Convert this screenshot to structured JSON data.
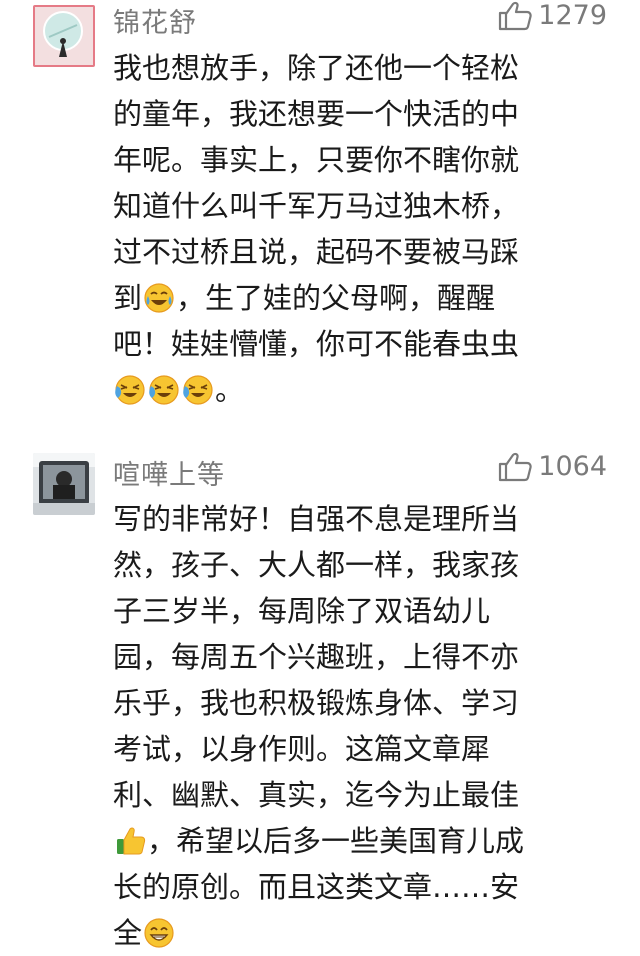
{
  "comments": [
    {
      "username": "锦花舒",
      "likes": "1279",
      "lines": [
        [
          "我也想放手，除了还他一个轻松"
        ],
        [
          "的童年，我还想要一个快活的中"
        ],
        [
          "年呢。事实上，只要你不瞎你就"
        ],
        [
          "知道什么叫千军万马过独木桥，"
        ],
        [
          "过不过桥且说，起码不要被马踩"
        ],
        [
          "到",
          "，生了娃的父母啊，醒醒"
        ],
        [
          "吧！娃娃懵懂，你可不能春虫虫"
        ],
        [
          "。"
        ]
      ],
      "emojis": [
        "tears-of-joy-emoji",
        "crying-laughing-emoji"
      ]
    },
    {
      "username": "喧嘩上等",
      "likes": "1064",
      "lines": [
        [
          "写的非常好！自强不息是理所当"
        ],
        [
          "然，孩子、大人都一样，我家孩"
        ],
        [
          "子三岁半，每周除了双语幼儿"
        ],
        [
          "园，每周五个兴趣班，上得不亦"
        ],
        [
          "乐乎，我也积极锻炼身体、学习"
        ],
        [
          "考试，以身作则。这篇文章犀"
        ],
        [
          "利、幽默、真实，迄今为止最佳"
        ],
        [
          "，希望以后多一些美国育儿成"
        ],
        [
          "长的原创。而且这类文章……安"
        ],
        [
          "全"
        ]
      ],
      "emojis": [
        "thumbs-up-emoji",
        "grinning-emoji"
      ]
    }
  ],
  "colors": {
    "meta_gray": "#7a7a7a",
    "text": "#1a1a1a",
    "emoji_yellow": "#f7c531",
    "emoji_orange": "#e79a1f",
    "tear_blue": "#4fa3e0",
    "avatar1_bg": "#cfe9e6",
    "avatar1_border": "#e36c7a"
  }
}
